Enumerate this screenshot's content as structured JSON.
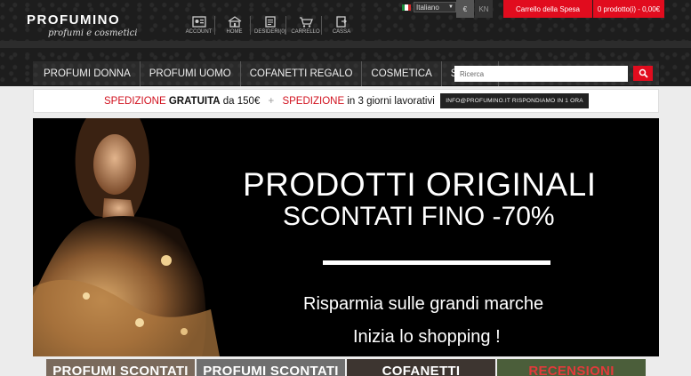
{
  "brand": {
    "name": "PROFUMINO",
    "tagline": "profumi e cosmetici"
  },
  "icon_nav": [
    {
      "label": "ACCOUNT",
      "icon": "account-icon"
    },
    {
      "label": "HOME",
      "icon": "home-icon"
    },
    {
      "label": "DESIDERI(0)",
      "icon": "wishlist-icon"
    },
    {
      "label": "CARRELLO",
      "icon": "cart-icon"
    },
    {
      "label": "CASSA",
      "icon": "checkout-icon"
    }
  ],
  "language": {
    "selected": "Italiano",
    "flag": "italy-flag-icon"
  },
  "currency": {
    "eur": "€",
    "kn": "KN"
  },
  "cart": {
    "label": "Carrello della Spesa",
    "summary": "0 prodotto(i) - 0,00€"
  },
  "menu": [
    "PROFUMI DONNA",
    "PROFUMI UOMO",
    "COFANETTI REGALO",
    "COSMETICA",
    "SCONTI"
  ],
  "search": {
    "placeholder": "Ricerca",
    "icon": "search-icon"
  },
  "shipping": {
    "part1_red": "SPEDIZIONE",
    "part1_bold": "GRATUITA",
    "part1_rest": "da 150€",
    "separator": "+",
    "part2_red": "SPEDIZIONE",
    "part2_rest": "in 3 giorni lavorativi",
    "email_button": "INFO@PROFUMINO.IT RISPONDIAMO IN 1 ORA"
  },
  "banner": {
    "title": "PRODOTTI ORIGINALI",
    "subtitle": "SCONTATI FINO -70%",
    "tagline1": "Risparmia sulle grandi marche",
    "tagline2": "Inizia lo shopping !"
  },
  "tiles": [
    "PROFUMI SCONTATI",
    "PROFUMI SCONTATI",
    "COFANETTI",
    "RECENSIONI"
  ],
  "colors": {
    "accent": "#e10c1e",
    "dark": "#1d1d1d",
    "ship_red": "#d1121f"
  }
}
